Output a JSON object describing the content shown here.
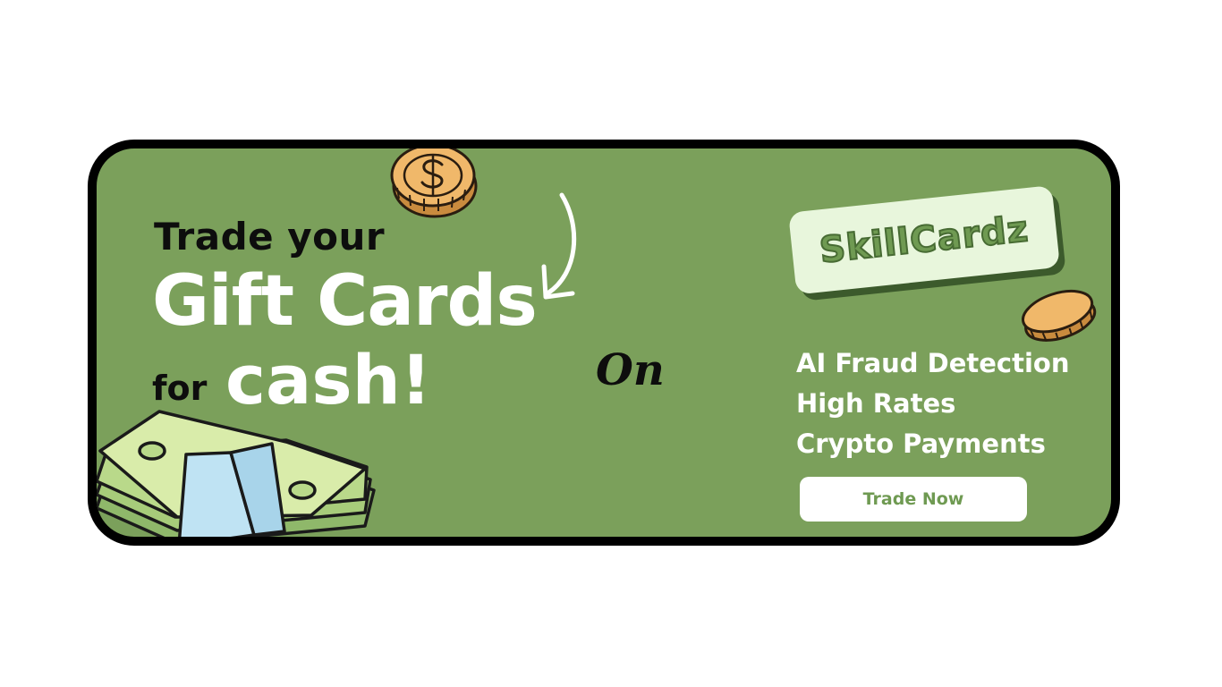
{
  "headline": {
    "line1": "Trade your",
    "line2": "Gift Cards",
    "line3_small": "for",
    "line3_large": "cash!"
  },
  "connector": "On",
  "brand": {
    "logo_text": "SkillCardz"
  },
  "features": [
    "AI Fraud Detection",
    "High Rates",
    "Crypto Payments"
  ],
  "cta": {
    "label": "Trade Now"
  },
  "colors": {
    "banner_bg": "#7ba05b",
    "border": "#000000",
    "logo_bg": "#e8f6dc",
    "logo_text": "#6f9a52",
    "coin": "#f0b86a",
    "cash": "#cfe6a0",
    "band": "#bfe3f3"
  },
  "icons": [
    "dollar-coin-icon",
    "curved-arrow-icon",
    "coin-icon",
    "cash-stack-icon"
  ]
}
